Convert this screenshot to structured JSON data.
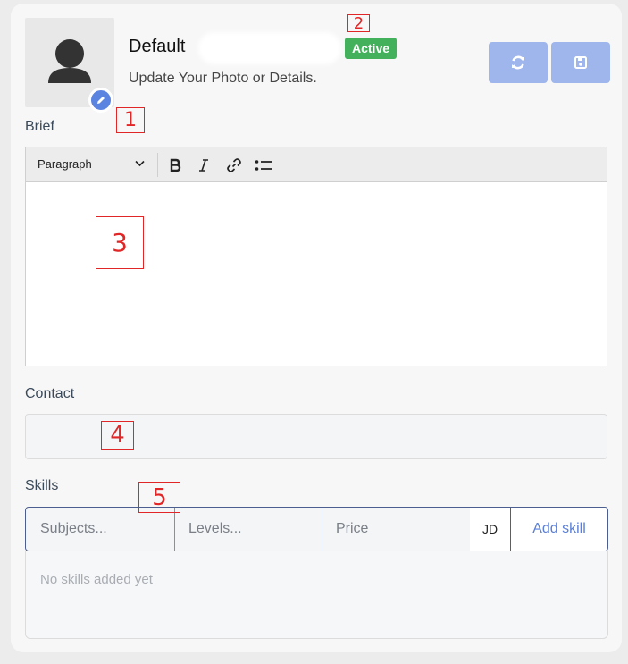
{
  "profile": {
    "name": "Default",
    "status_badge": "Active",
    "subtitle": "Update Your Photo or Details.",
    "avatar_icon": "user-silhouette-icon",
    "edit_icon": "pencil-icon"
  },
  "actions": {
    "refresh_icon": "refresh-icon",
    "save_icon": "floppy-save-icon"
  },
  "brief": {
    "label": "Brief",
    "toolbar": {
      "block_format": "Paragraph",
      "buttons": [
        "bold-icon",
        "italic-icon",
        "link-icon",
        "bulleted-list-icon"
      ]
    },
    "content": ""
  },
  "contact": {
    "label": "Contact",
    "value": ""
  },
  "skills": {
    "label": "Skills",
    "subjects_placeholder": "Subjects...",
    "levels_placeholder": "Levels...",
    "price_placeholder": "Price",
    "currency": "JD",
    "add_button": "Add skill",
    "empty_text": "No skills added yet"
  },
  "annotations": [
    "1",
    "2",
    "3",
    "4",
    "5"
  ],
  "colors": {
    "accent": "#5b83e0",
    "badge_green": "#43b05c",
    "action_button": "#9fb6ec",
    "annotation_red": "#e02626"
  }
}
